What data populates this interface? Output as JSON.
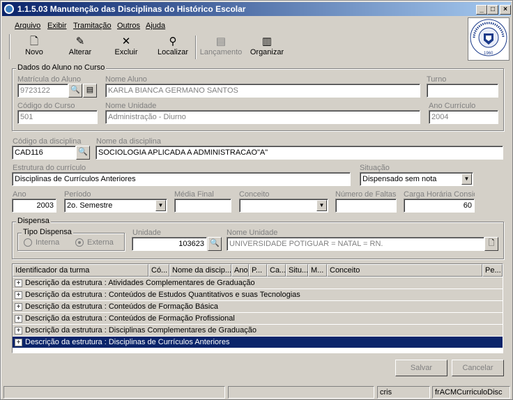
{
  "window": {
    "title": "1.1.5.03 Manutenção das Disciplinas do Histórico Escolar"
  },
  "menu": {
    "items": [
      "Arquivo",
      "Exibir",
      "Tramitação",
      "Outros",
      "Ajuda"
    ]
  },
  "toolbar": {
    "novo": "Novo",
    "alterar": "Alterar",
    "excluir": "Excluir",
    "localizar": "Localizar",
    "lancamento": "Lançamento",
    "organizar": "Organizar"
  },
  "logo": {
    "text": "Universidade Federal de Santa Maria",
    "year": "1960"
  },
  "aluno": {
    "group_title": "Dados do Aluno no Curso",
    "matricula_label": "Matrícula do Aluno",
    "matricula": "9723122",
    "nome_label": "Nome Aluno",
    "nome": "KARLA BIANCA GERMANO SANTOS",
    "turno_label": "Turno",
    "turno": "",
    "codcurso_label": "Código do Curso",
    "codcurso": "501",
    "unidade_label": "Nome Unidade",
    "unidade": "Administração - Diurno",
    "anocurr_label": "Ano Currículo",
    "anocurr": "2004"
  },
  "disciplina": {
    "codigo_label": "Código da disciplina",
    "codigo": "CAD116",
    "nome_label": "Nome da disciplina",
    "nome": "SOCIOLOGIA APLICADA A ADMINISTRACAO\"A\"",
    "estrutura_label": "Estrutura do currículo",
    "estrutura": "Disciplinas de Currículos Anteriores",
    "situacao_label": "Situação",
    "situacao": "Dispensado sem  nota",
    "ano_label": "Ano",
    "ano": "2003",
    "periodo_label": "Período",
    "periodo": "2o. Semestre",
    "media_label": "Média Final",
    "media": "",
    "conceito_label": "Conceito",
    "conceito": "",
    "faltas_label": "Número de Faltas",
    "faltas": "",
    "carga_label": "Carga Horária Consid",
    "carga": "60"
  },
  "dispensa": {
    "group_title": "Dispensa",
    "tipo_title": "Tipo Dispensa",
    "interna": "Interna",
    "externa": "Externa",
    "unidade_label": "Unidade",
    "unidade": "103623",
    "nome_label": "Nome Unidade",
    "nome": "UNIVERSIDADE POTIGUAR = NATAL = RN."
  },
  "grid": {
    "headers": [
      "Identificador da turma",
      "Có...",
      "Nome da discip...",
      "Ano",
      "P...",
      "Ca...",
      "Situ...",
      "M...",
      "Conceito",
      "Pe..."
    ],
    "rows": [
      "Descrição da estrutura : Atividades Complementares de Graduação",
      "Descrição da estrutura : Conteúdos de Estudos Quantitativos e suas Tecnologias",
      "Descrição da estrutura : Conteúdos de Formação Básica",
      "Descrição da estrutura : Conteúdos de Formação Profissional",
      "Descrição da estrutura : Disciplinas Complementares de Graduação",
      "Descrição da estrutura : Disciplinas de Currículos Anteriores"
    ]
  },
  "buttons": {
    "salvar": "Salvar",
    "cancelar": "Cancelar"
  },
  "status": {
    "user": "cris",
    "form": "frACMCurriculoDisc"
  }
}
